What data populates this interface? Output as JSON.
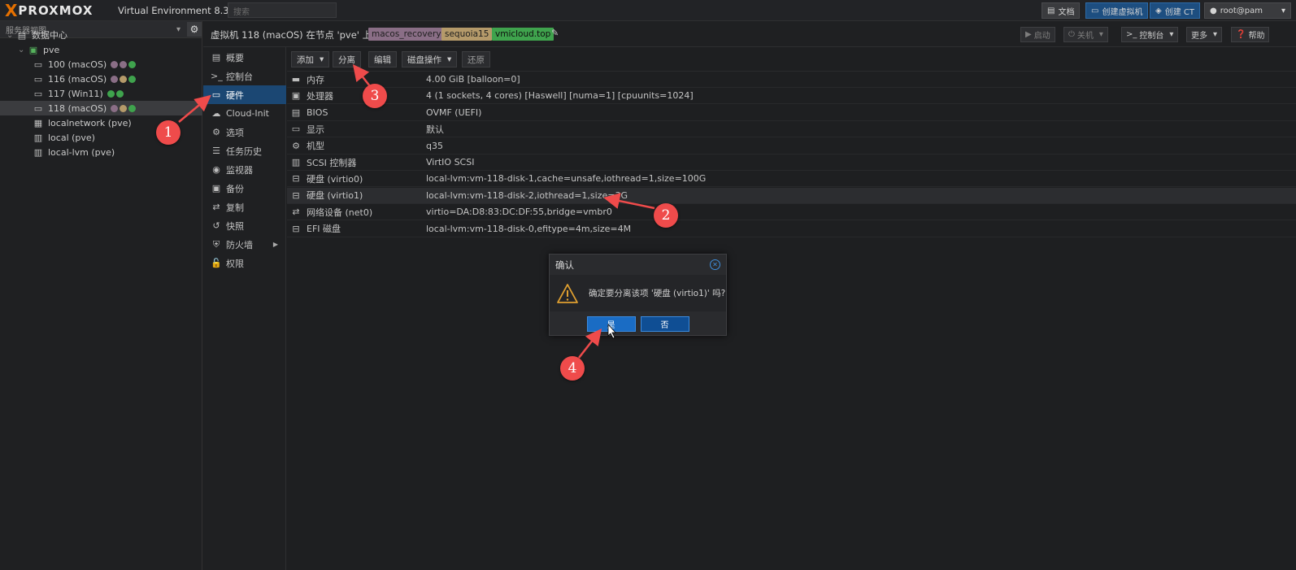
{
  "topbar": {
    "logo": "PROXMOX",
    "logo_mark": "X",
    "product": "Virtual Environment 8.3.0",
    "search_placeholder": "搜索",
    "docs": "文档",
    "create_vm": "创建虚拟机",
    "create_ct": "创建 CT",
    "user": "root@pam"
  },
  "tree": {
    "view": "服务器视图",
    "items": [
      {
        "label": "数据中心",
        "icon": "datacenter-icon"
      },
      {
        "label": "pve",
        "icon": "node-icon"
      },
      {
        "label": "100 (macOS)",
        "icon": "vm-icon",
        "dots": [
          "#8a6e86",
          "#8a6e86",
          "#3fa34d"
        ]
      },
      {
        "label": "116 (macOS)",
        "icon": "vm-icon",
        "dots": [
          "#8a6e86",
          "#b59a6a",
          "#3fa34d"
        ]
      },
      {
        "label": "117 (Win11)",
        "icon": "vm-icon",
        "dots": [
          "#3fa34d",
          "#3fa34d"
        ]
      },
      {
        "label": "118 (macOS)",
        "icon": "vm-icon",
        "dots": [
          "#8a6e86",
          "#b59a6a",
          "#3fa34d"
        ]
      },
      {
        "label": "localnetwork (pve)",
        "icon": "network-grid-icon"
      },
      {
        "label": "local (pve)",
        "icon": "storage-icon"
      },
      {
        "label": "local-lvm (pve)",
        "icon": "storage-icon"
      }
    ]
  },
  "vm_header": {
    "title": "虚拟机 118 (macOS) 在节点 'pve' 上",
    "tags": [
      {
        "label": "macos_recovery",
        "bg": "#8a6e86",
        "fg": "#1e1e1e"
      },
      {
        "label": "sequoia15",
        "bg": "#b59a6a",
        "fg": "#1e1e1e"
      },
      {
        "label": "vmicloud.top",
        "bg": "#3fa34d",
        "fg": "#0e0e0e"
      }
    ],
    "start": "启动",
    "shutdown": "关机",
    "console": "控制台",
    "more": "更多",
    "help": "帮助"
  },
  "menu": [
    {
      "label": "概要",
      "icon": "book-icon"
    },
    {
      "label": "控制台",
      "icon": "terminal-icon"
    },
    {
      "label": "硬件",
      "icon": "monitor-icon"
    },
    {
      "label": "Cloud-Init",
      "icon": "cloud-icon"
    },
    {
      "label": "选项",
      "icon": "gear-icon"
    },
    {
      "label": "任务历史",
      "icon": "list-icon"
    },
    {
      "label": "监视器",
      "icon": "eye-icon"
    },
    {
      "label": "备份",
      "icon": "floppy-icon"
    },
    {
      "label": "复制",
      "icon": "retweet-icon"
    },
    {
      "label": "快照",
      "icon": "history-icon"
    },
    {
      "label": "防火墙",
      "icon": "shield-icon"
    },
    {
      "label": "权限",
      "icon": "unlock-icon"
    }
  ],
  "toolbar": {
    "add": "添加",
    "detach": "分离",
    "edit": "编辑",
    "disk_action": "磁盘操作",
    "revert": "还原"
  },
  "hardware": [
    {
      "name": "内存",
      "value": "4.00 GiB [balloon=0]",
      "icon": "memory-icon"
    },
    {
      "name": "处理器",
      "value": "4 (1 sockets, 4 cores) [Haswell] [numa=1] [cpuunits=1024]",
      "icon": "cpu-icon"
    },
    {
      "name": "BIOS",
      "value": "OVMF (UEFI)",
      "icon": "bios-icon"
    },
    {
      "name": "显示",
      "value": "默认",
      "icon": "display-icon"
    },
    {
      "name": "机型",
      "value": "q35",
      "icon": "cogs-icon"
    },
    {
      "name": "SCSI 控制器",
      "value": "VirtIO SCSI",
      "icon": "database-icon"
    },
    {
      "name": "硬盘 (virtio0)",
      "value": "local-lvm:vm-118-disk-1,cache=unsafe,iothread=1,size=100G",
      "icon": "hdd-icon"
    },
    {
      "name": "硬盘 (virtio1)",
      "value": "local-lvm:vm-118-disk-2,iothread=1,size=3G",
      "icon": "hdd-icon"
    },
    {
      "name": "网络设备 (net0)",
      "value": "virtio=DA:D8:83:DC:DF:55,bridge=vmbr0",
      "icon": "exchange-icon"
    },
    {
      "name": "EFI 磁盘",
      "value": "local-lvm:vm-118-disk-0,efitype=4m,size=4M",
      "icon": "hdd-icon"
    }
  ],
  "dialog": {
    "title": "确认",
    "message": "确定要分离该项 '硬盘 (virtio1)' 吗?",
    "yes": "是",
    "no": "否"
  },
  "annotations": [
    "1",
    "2",
    "3",
    "4"
  ],
  "colors": {
    "accent": "#1b4773",
    "annotation": "#ef4b4b",
    "logo": "#e57000"
  }
}
